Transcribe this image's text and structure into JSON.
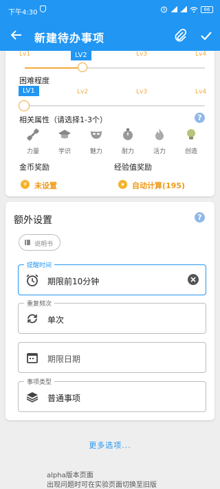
{
  "status": {
    "time": "下午4:30",
    "battery": "66"
  },
  "appbar": {
    "title": "新建待办事项"
  },
  "importance": {
    "levels": [
      "Lv1",
      "LV2",
      "Lv3",
      "Lv4"
    ],
    "selected": "LV2",
    "value_fraction": 0.333
  },
  "difficulty": {
    "label": "困难程度",
    "levels": [
      "LV1",
      "Lv2",
      "Lv3",
      "Lv4"
    ],
    "selected": "LV1",
    "value_fraction": 0.0
  },
  "attributes": {
    "label": "相关属性（请选择1-3个）",
    "items": [
      {
        "label": "力量",
        "icon": "dumbbell-icon"
      },
      {
        "label": "学识",
        "icon": "graduation-cap-icon"
      },
      {
        "label": "魅力",
        "icon": "mask-icon"
      },
      {
        "label": "耐力",
        "icon": "stopwatch-icon"
      },
      {
        "label": "活力",
        "icon": "flame-icon"
      },
      {
        "label": "创造",
        "icon": "lightbulb-icon"
      }
    ]
  },
  "rewards": {
    "gold_label": "金币奖励",
    "gold_value": "未设置",
    "gold_symbol": "¥",
    "exp_label": "经验值奖励",
    "exp_value": "自动计算(195)",
    "exp_symbol": "★"
  },
  "extra": {
    "title": "额外设置",
    "manual_chip": "说明书",
    "reminder": {
      "label": "提醒时间",
      "value": "期限前10分钟"
    },
    "repeat": {
      "label": "重复频次",
      "value": "单次"
    },
    "deadline": {
      "placeholder": "期限日期"
    },
    "type": {
      "label": "事项类型",
      "value": "普通事项"
    }
  },
  "more_options": "更多选项...",
  "footer": {
    "line1": "alpha版本页面",
    "line2": "出现问题时可在实验页面切换至旧版"
  },
  "colors": {
    "primary": "#2196f3",
    "accent": "#f2a93b"
  }
}
